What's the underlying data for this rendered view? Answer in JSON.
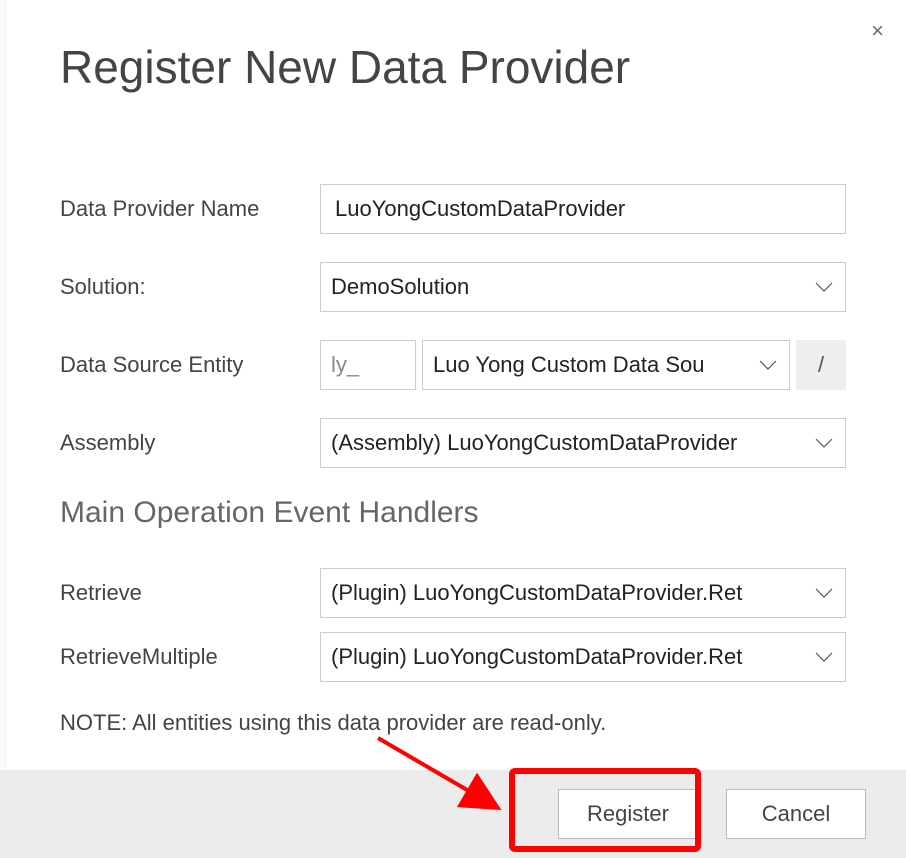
{
  "dialog": {
    "title": "Register New Data Provider",
    "fields": {
      "provider_name": {
        "label": "Data Provider Name",
        "value": "LuoYongCustomDataProvider"
      },
      "solution": {
        "label": "Solution:",
        "value": "DemoSolution"
      },
      "entity": {
        "label": "Data Source Entity",
        "prefix": "ly_",
        "value": "Luo Yong Custom Data Sou",
        "slash": "/"
      },
      "assembly": {
        "label": "Assembly",
        "value": "(Assembly) LuoYongCustomDataProvider"
      }
    },
    "section_title": "Main Operation Event Handlers",
    "handlers": {
      "retrieve": {
        "label": "Retrieve",
        "value": "(Plugin) LuoYongCustomDataProvider.Ret"
      },
      "retrieve_multiple": {
        "label": "RetrieveMultiple",
        "value": "(Plugin) LuoYongCustomDataProvider.Ret"
      }
    },
    "note": "NOTE: All entities using this data provider are read-only.",
    "buttons": {
      "register": "Register",
      "cancel": "Cancel"
    },
    "close": "×"
  }
}
